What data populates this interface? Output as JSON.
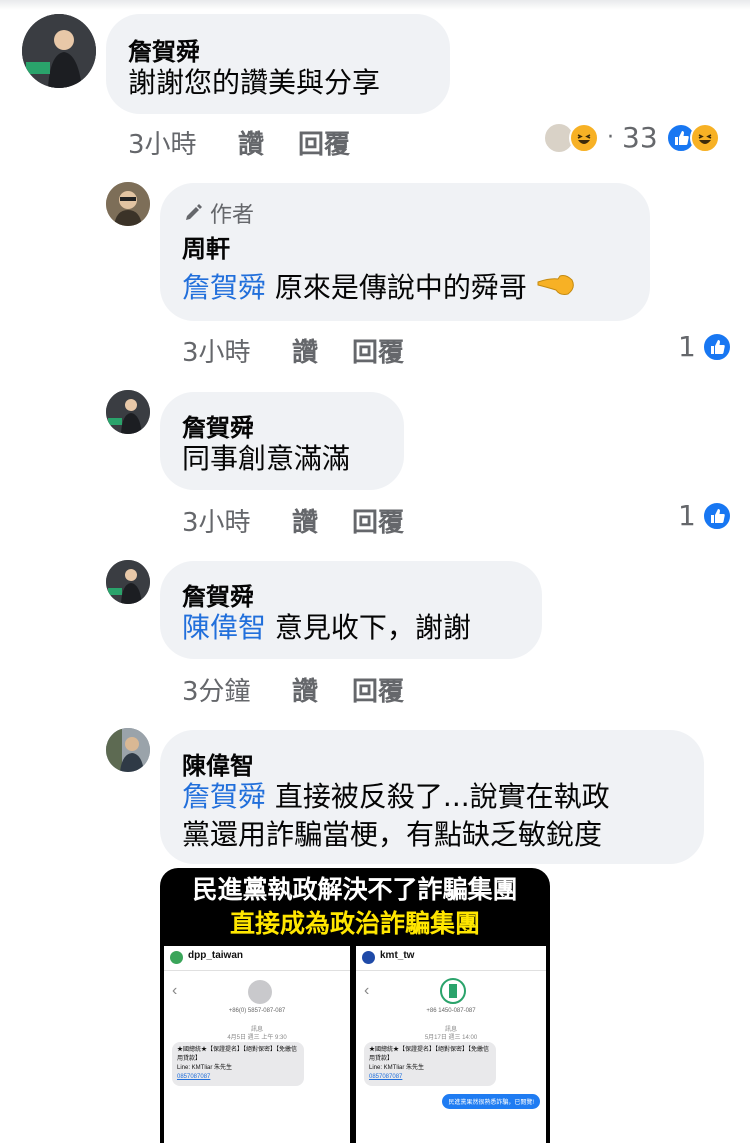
{
  "comment_main": {
    "author": "詹賀舜",
    "text": "謝謝您的讚美與分享",
    "time": "3小時",
    "like_label": "讚",
    "reply_label": "回覆",
    "reaction_count": "33"
  },
  "reply_1": {
    "author_badge": "作者",
    "author": "周軒",
    "mention": "詹賀舜",
    "text": "原來是傳說中的舜哥",
    "time": "3小時",
    "like_label": "讚",
    "reply_label": "回覆",
    "reaction_count": "1"
  },
  "reply_2": {
    "author": "詹賀舜",
    "text": "同事創意滿滿",
    "time": "3小時",
    "like_label": "讚",
    "reply_label": "回覆",
    "reaction_count": "1"
  },
  "reply_3": {
    "author": "詹賀舜",
    "mention": "陳偉智",
    "text": "意見收下，謝謝",
    "time": "3分鐘",
    "like_label": "讚",
    "reply_label": "回覆"
  },
  "reply_4": {
    "author": "陳偉智",
    "mention": "詹賀舜",
    "text_line1": "直接被反殺了...說實在執政",
    "text_line2": "黨還用詐騙當梗，有點缺乏敏銳度"
  },
  "attachment": {
    "headline1": "民進黨執政解決不了詐騙集團",
    "headline2": "直接成為政治詐騙集團",
    "left_account": "dpp_taiwan",
    "right_account": "kmt_tw",
    "left_phone": "+86(0) 5857-087-087",
    "right_phone": "+86 1450-087-087",
    "left_label": "訊息",
    "right_label": "訊息",
    "left_date": "4月5日 週三 上午 9:30",
    "right_date": "5月17日 週三 14:00",
    "left_msg1": "★國總統★【保證提名】【絕對保密】【免繳信用貸款】",
    "left_msg2": "Line: KMTliar 朱先生",
    "left_msg3": "0857087087",
    "right_msg1": "★國總統★【保證提名】【絕對保密】【免繳信用貸款】",
    "right_msg2": "Line: KMTliar 朱先生",
    "right_msg3": "0857087087",
    "right_reply": "民進黨果然很熟悉詐騙，已閱覽!"
  },
  "colors": {
    "bubble": "#f0f2f5",
    "mention": "#216fdb",
    "meta": "#65676b",
    "like_blue": "#1877f2",
    "haha_yellow": "#f7b125",
    "headline_yellow": "#ffe600"
  },
  "icons": [
    "pencil-icon",
    "like-icon",
    "haha-icon"
  ]
}
